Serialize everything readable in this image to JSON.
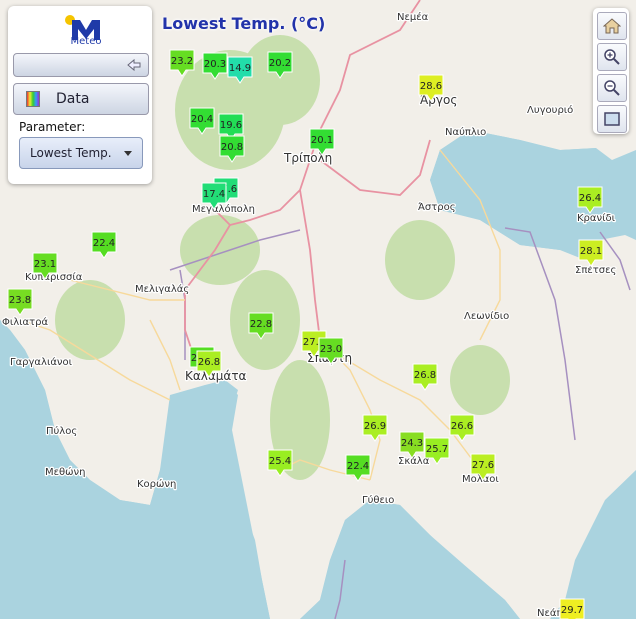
{
  "title": "Lowest Temp. (°C)",
  "panel": {
    "logo_text": "Meteo",
    "data_label": "Data",
    "parameter_label": "Parameter:",
    "parameter_value": "Lowest Temp."
  },
  "colors": {
    "title": "#2233aa",
    "sea": "#aad3df",
    "land": "#f2efe9",
    "forest": "#c8dfae",
    "road_primary": "#e892a2",
    "road_secondary": "#f7d99b",
    "border": "#a690c0",
    "logo_blue": "#1f3aa8",
    "logo_yellow": "#f5c400"
  },
  "tools": [
    "home-icon",
    "zoom-in-icon",
    "zoom-out-icon",
    "fullscreen-icon"
  ],
  "places": [
    {
      "name": "Νεμέα"
    },
    {
      "name": "Άργος"
    },
    {
      "name": "Ναύπλιο"
    },
    {
      "name": "Λυγουριό"
    },
    {
      "name": "Τρίπολη"
    },
    {
      "name": "Μεγαλόπολη"
    },
    {
      "name": "Άστρος"
    },
    {
      "name": "Κρανίδι"
    },
    {
      "name": "Σπέτσες"
    },
    {
      "name": "Κυπαρισσία"
    },
    {
      "name": "Μελιγαλάς"
    },
    {
      "name": "Φιλιατρά"
    },
    {
      "name": "Γαργαλιάνοι"
    },
    {
      "name": "Λεωνίδιο"
    },
    {
      "name": "Σπάρτη"
    },
    {
      "name": "Καλαμάτα"
    },
    {
      "name": "Πύλος"
    },
    {
      "name": "Μεθώνη"
    },
    {
      "name": "Κορώνη"
    },
    {
      "name": "Σκάλα"
    },
    {
      "name": "Μολάοι"
    },
    {
      "name": "Γύθειο"
    },
    {
      "name": "Νεάπολη"
    }
  ],
  "stations": [
    {
      "value": "23.2",
      "color": "#66dd22"
    },
    {
      "value": "20.3",
      "color": "#33dd33"
    },
    {
      "value": "14.9",
      "color": "#22ddaa"
    },
    {
      "value": "20.2",
      "color": "#33dd33"
    },
    {
      "value": "28.6",
      "color": "#ddee22"
    },
    {
      "value": "20.4",
      "color": "#33dd33"
    },
    {
      "value": "19.6",
      "color": "#22dd55"
    },
    {
      "value": "20.8",
      "color": "#33dd33"
    },
    {
      "value": "20.1",
      "color": "#33dd33"
    },
    {
      "value": "17.6",
      "color": "#22dd77"
    },
    {
      "value": "17.4",
      "color": "#22dd77"
    },
    {
      "value": "26.4",
      "color": "#aaee22"
    },
    {
      "value": "28.1",
      "color": "#ccee22"
    },
    {
      "value": "22.4",
      "color": "#55dd22"
    },
    {
      "value": "23.1",
      "color": "#66dd22"
    },
    {
      "value": "23.8",
      "color": "#77dd22"
    },
    {
      "value": "22.8",
      "color": "#66dd22"
    },
    {
      "value": "27.1",
      "color": "#bbee22"
    },
    {
      "value": "23.0",
      "color": "#66dd22"
    },
    {
      "value": "22.0",
      "color": "#55dd22"
    },
    {
      "value": "26.8",
      "color": "#aaee22"
    },
    {
      "value": "26.8",
      "color": "#aaee22"
    },
    {
      "value": "26.9",
      "color": "#aaee22"
    },
    {
      "value": "26.6",
      "color": "#aaee22"
    },
    {
      "value": "24.3",
      "color": "#88dd22"
    },
    {
      "value": "25.7",
      "color": "#99ee22"
    },
    {
      "value": "25.4",
      "color": "#99ee22"
    },
    {
      "value": "22.4",
      "color": "#55dd22"
    },
    {
      "value": "27.6",
      "color": "#bbee22"
    },
    {
      "value": "29.7",
      "color": "#eeee22"
    }
  ]
}
